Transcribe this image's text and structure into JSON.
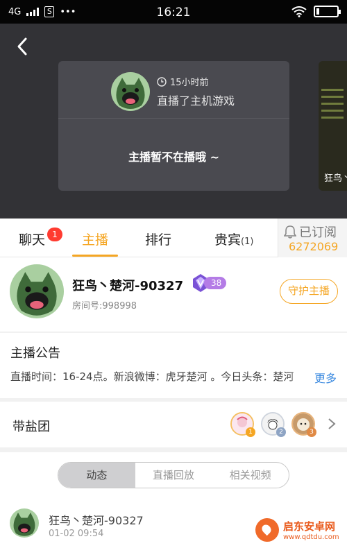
{
  "status_bar": {
    "network": "4G",
    "sim": "S",
    "dots": "•••",
    "time": "16:21"
  },
  "hero": {
    "card": {
      "time_ago": "15小时前",
      "activity": "直播了主机游戏",
      "offline_text": "主播暂不在播哦 ~"
    },
    "side_card_label": "狂鸟丶"
  },
  "tabs": {
    "chat": "聊天",
    "chat_badge": "1",
    "streamer": "主播",
    "ranking": "排行",
    "guests": "贵宾",
    "guests_count": "(1)",
    "subscribed": "已订阅",
    "subscriber_count": "6272069"
  },
  "streamer": {
    "name": "狂鸟丶楚河-90327",
    "level": "38",
    "room_id": "房间号:998998",
    "guard_button": "守护主播"
  },
  "notice": {
    "title": "主播公告",
    "text": "直播时间：16-24点。新浪微博：虎牙楚河 。今日头条：楚河",
    "more": "更多"
  },
  "fan_group": {
    "title": "带盐团",
    "ranks": [
      "1",
      "2",
      "3"
    ]
  },
  "feed": {
    "segments": [
      "动态",
      "直播回放",
      "相关视频"
    ],
    "post": {
      "author": "狂鸟丶楚河-90327",
      "time": "01-02 09:54"
    }
  },
  "watermark": {
    "name": "启东安卓网",
    "url": "www.qdtdu.com"
  },
  "colors": {
    "accent": "#f5a623",
    "badge": "#ff3b30",
    "link": "#3d8be0",
    "dark_bg": "#323236"
  }
}
